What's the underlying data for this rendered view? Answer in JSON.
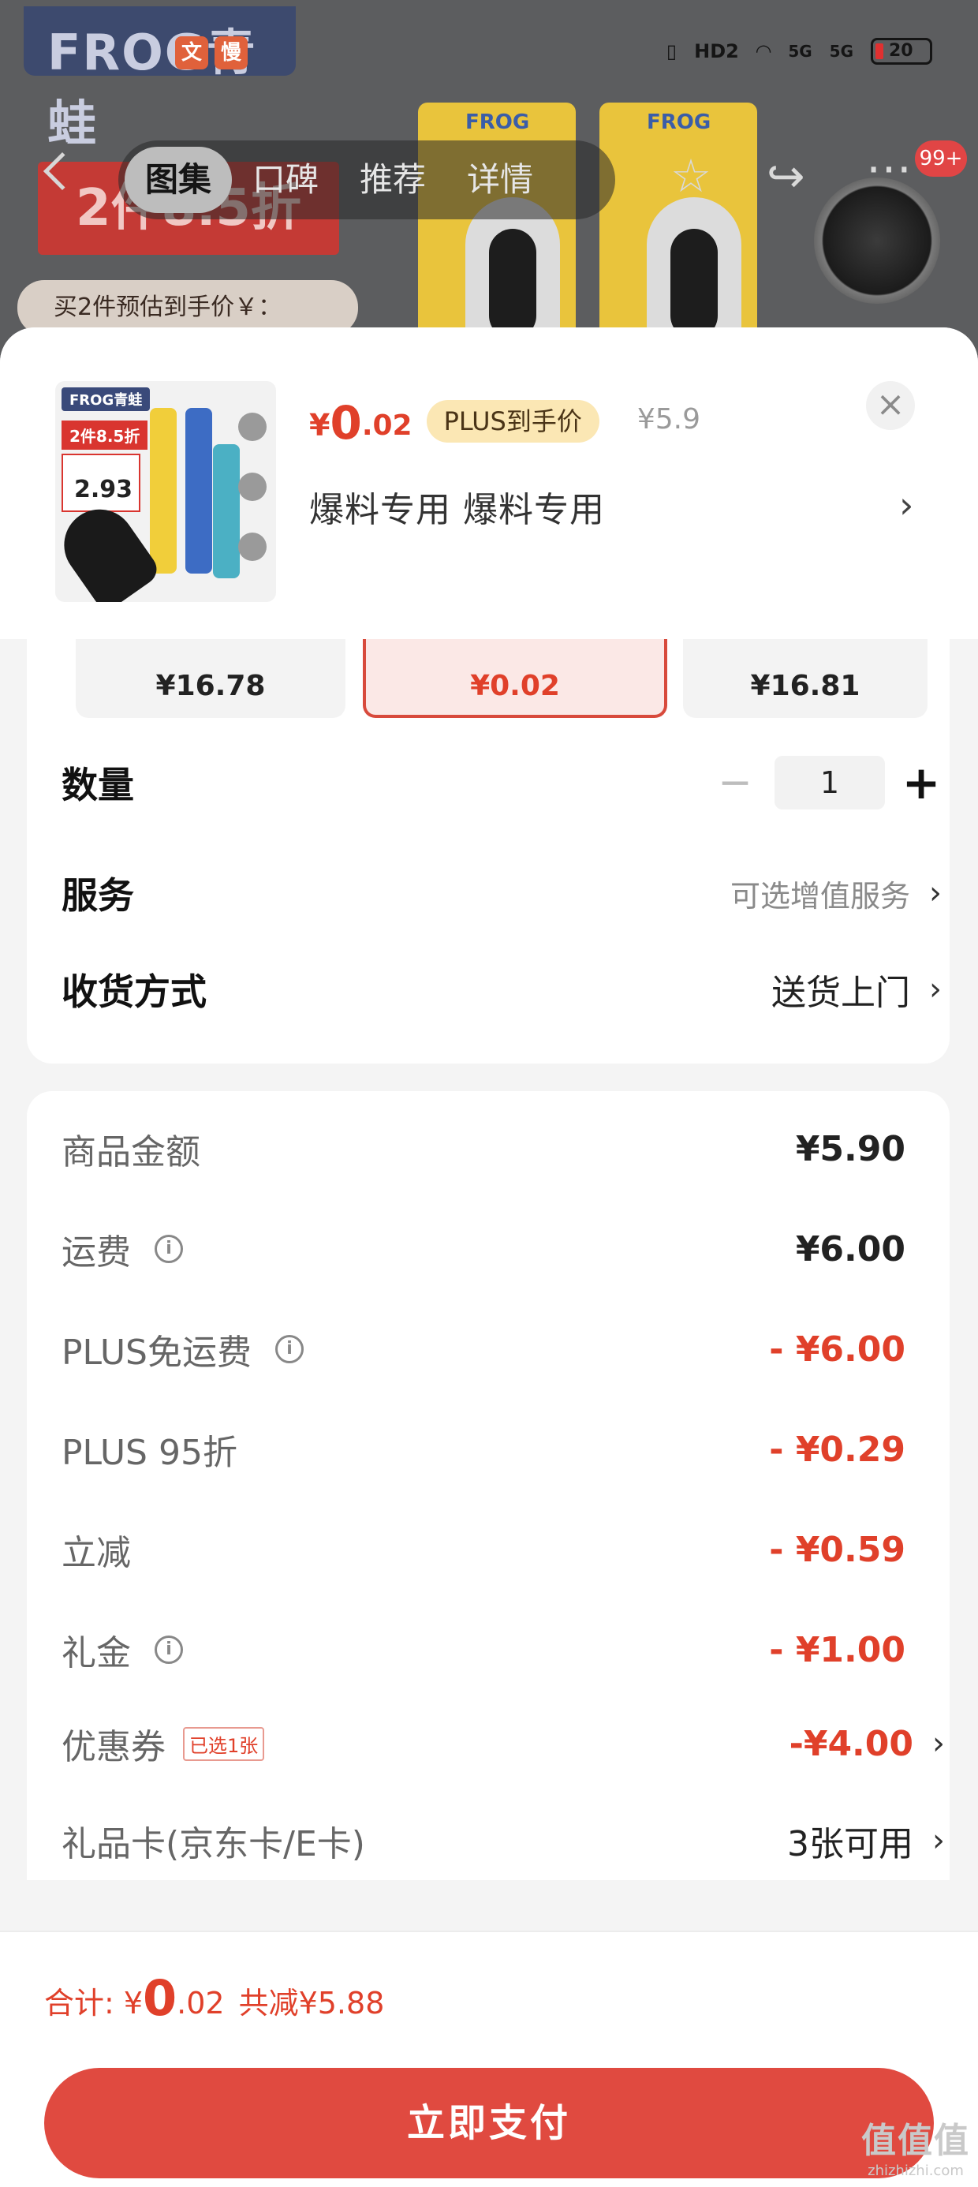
{
  "background": {
    "brand_text": "FROG青蛙",
    "app_badges": [
      "文",
      "慢"
    ],
    "status_bar": {
      "hd": "HD2",
      "signal1": "5G",
      "signal2": "5G",
      "battery": "20"
    },
    "promo_tag": "2件8.5折",
    "estimate_text": "买2件预估到手价￥：",
    "pack_label": "FROG",
    "tabs": [
      "图集",
      "口碑",
      "推荐",
      "详情"
    ],
    "active_tab": "图集",
    "message_count": "99+"
  },
  "product": {
    "thumb_brand": "FROG青蛙",
    "thumb_promo": "2件8.5折",
    "thumb_price": "2.93",
    "price_symbol": "¥",
    "price_int": "0",
    "price_dec": ".02",
    "plus_label": "PLUS到手价",
    "original_price": "¥5.9",
    "spec": "爆料专用  爆料专用",
    "close_icon": "×"
  },
  "skus": [
    {
      "price": "¥16.78",
      "selected": false
    },
    {
      "price": "¥0.02",
      "selected": true
    },
    {
      "price": "¥16.81",
      "selected": false
    }
  ],
  "quantity": {
    "label": "数量",
    "value": "1"
  },
  "service": {
    "label": "服务",
    "value": "可选增值服务"
  },
  "delivery": {
    "label": "收货方式",
    "value": "送货上门"
  },
  "fees": {
    "goods": {
      "label": "商品金额",
      "value": "¥5.90"
    },
    "shipping": {
      "label": "运费",
      "value": "¥6.00"
    },
    "plus_free_ship": {
      "label": "PLUS免运费",
      "value": "- ¥6.00"
    },
    "plus_discount": {
      "label": "PLUS 95折",
      "value": "- ¥0.29"
    },
    "instant_cut": {
      "label": "立减",
      "value": "- ¥0.59"
    },
    "gift_money": {
      "label": "礼金",
      "value": "- ¥1.00"
    },
    "coupon": {
      "label": "优惠券",
      "tag": "已选1张",
      "value": "-¥4.00"
    },
    "gift_card": {
      "label": "礼品卡(京东卡/E卡)",
      "value": "3张可用"
    }
  },
  "footer": {
    "total_label": "合计:",
    "total_symbol": "¥",
    "total_int": "0",
    "total_dec": ".02",
    "saved": "共减¥5.88",
    "pay_button": "立即支付"
  },
  "watermark": {
    "main": "值值值",
    "sub": "zhizhizhi.com"
  },
  "colors": {
    "accent": "#e0402a",
    "button": "#e04a40",
    "plus_pill": "#fbe7b4"
  }
}
